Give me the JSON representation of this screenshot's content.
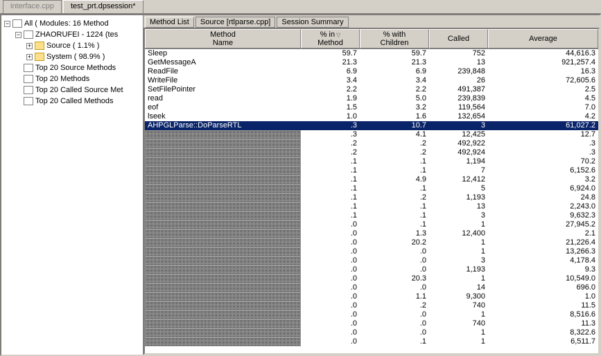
{
  "topTabs": [
    {
      "label": "interface.cpp",
      "active": false
    },
    {
      "label": "test_prt.dpsession*",
      "active": true
    }
  ],
  "tree": {
    "root": {
      "label": "All ( Modules: 16 Method"
    },
    "child1": {
      "label": "ZHAORUFEI - 1224 (tes"
    },
    "leaf1": {
      "label": "Source ( 1.1% )"
    },
    "leaf2": {
      "label": "System ( 98.9% )"
    },
    "t1": {
      "label": "Top 20 Source Methods"
    },
    "t2": {
      "label": "Top 20 Methods"
    },
    "t3": {
      "label": "Top 20 Called Source Met"
    },
    "t4": {
      "label": "Top 20 Called Methods"
    }
  },
  "innerTabs": [
    {
      "label": "Method List",
      "active": true
    },
    {
      "label": "Source [rtlparse.cpp]",
      "active": false
    },
    {
      "label": "Session Summary",
      "active": false
    }
  ],
  "columns": {
    "name1": "Method",
    "name2": "Name",
    "pct1": "% in",
    "pct2": "Method",
    "pctc1": "% with",
    "pctc2": "Children",
    "called": "Called",
    "avg": "Average"
  },
  "rows": [
    {
      "name": "Sleep",
      "pct": "59.7",
      "pctc": "59.7",
      "called": "752",
      "avg": "44,616.3",
      "obs": false,
      "sel": false
    },
    {
      "name": "GetMessageA",
      "pct": "21.3",
      "pctc": "21.3",
      "called": "13",
      "avg": "921,257.4",
      "obs": false,
      "sel": false
    },
    {
      "name": "ReadFile",
      "pct": "6.9",
      "pctc": "6.9",
      "called": "239,848",
      "avg": "16.3",
      "obs": false,
      "sel": false
    },
    {
      "name": "WriteFile",
      "pct": "3.4",
      "pctc": "3.4",
      "called": "26",
      "avg": "72,605.6",
      "obs": false,
      "sel": false
    },
    {
      "name": "SetFilePointer",
      "pct": "2.2",
      "pctc": "2.2",
      "called": "491,387",
      "avg": "2.5",
      "obs": false,
      "sel": false
    },
    {
      "name": "read",
      "pct": "1.9",
      "pctc": "5.0",
      "called": "239,839",
      "avg": "4.5",
      "obs": false,
      "sel": false
    },
    {
      "name": "eof",
      "pct": "1.5",
      "pctc": "3.2",
      "called": "119,564",
      "avg": "7.0",
      "obs": false,
      "sel": false
    },
    {
      "name": "lseek",
      "pct": "1.0",
      "pctc": "1.6",
      "called": "132,654",
      "avg": "4.2",
      "obs": false,
      "sel": false
    },
    {
      "name": "AHPGLParse::DoParseRTL",
      "pct": ".3",
      "pctc": "10.7",
      "called": "3",
      "avg": "61,027.2",
      "obs": false,
      "sel": true
    },
    {
      "name": "",
      "pct": ".3",
      "pctc": "4.1",
      "called": "12,425",
      "avg": "12.7",
      "obs": true,
      "sel": false
    },
    {
      "name": "",
      "pct": ".2",
      "pctc": ".2",
      "called": "492,922",
      "avg": ".3",
      "obs": true,
      "sel": false
    },
    {
      "name": "",
      "pct": ".2",
      "pctc": ".2",
      "called": "492,924",
      "avg": ".3",
      "obs": true,
      "sel": false
    },
    {
      "name": "",
      "pct": ".1",
      "pctc": ".1",
      "called": "1,194",
      "avg": "70.2",
      "obs": true,
      "sel": false
    },
    {
      "name": "",
      "pct": ".1",
      "pctc": ".1",
      "called": "7",
      "avg": "6,152.6",
      "obs": true,
      "sel": false
    },
    {
      "name": "",
      "pct": ".1",
      "pctc": "4.9",
      "called": "12,412",
      "avg": "3.2",
      "obs": true,
      "sel": false
    },
    {
      "name": "",
      "pct": ".1",
      "pctc": ".1",
      "called": "5",
      "avg": "6,924.0",
      "obs": true,
      "sel": false
    },
    {
      "name": "",
      "pct": ".1",
      "pctc": ".2",
      "called": "1,193",
      "avg": "24.8",
      "obs": true,
      "sel": false
    },
    {
      "name": "",
      "pct": ".1",
      "pctc": ".1",
      "called": "13",
      "avg": "2,243.0",
      "obs": true,
      "sel": false
    },
    {
      "name": "",
      "pct": ".1",
      "pctc": ".1",
      "called": "3",
      "avg": "9,632.3",
      "obs": true,
      "sel": false
    },
    {
      "name": "",
      "pct": ".0",
      "pctc": ".1",
      "called": "1",
      "avg": "27,945.2",
      "obs": true,
      "sel": false
    },
    {
      "name": "",
      "pct": ".0",
      "pctc": "1.3",
      "called": "12,400",
      "avg": "2.1",
      "obs": true,
      "sel": false
    },
    {
      "name": "",
      "pct": ".0",
      "pctc": "20.2",
      "called": "1",
      "avg": "21,226.4",
      "obs": true,
      "sel": false
    },
    {
      "name": "",
      "pct": ".0",
      "pctc": ".0",
      "called": "1",
      "avg": "13,266.3",
      "obs": true,
      "sel": false
    },
    {
      "name": "",
      "pct": ".0",
      "pctc": ".0",
      "called": "3",
      "avg": "4,178.4",
      "obs": true,
      "sel": false
    },
    {
      "name": "",
      "pct": ".0",
      "pctc": ".0",
      "called": "1,193",
      "avg": "9.3",
      "obs": true,
      "sel": false
    },
    {
      "name": "",
      "pct": ".0",
      "pctc": "20.3",
      "called": "1",
      "avg": "10,549.0",
      "obs": true,
      "sel": false
    },
    {
      "name": "",
      "pct": ".0",
      "pctc": ".0",
      "called": "14",
      "avg": "696.0",
      "obs": true,
      "sel": false
    },
    {
      "name": "",
      "pct": ".0",
      "pctc": "1.1",
      "called": "9,300",
      "avg": "1.0",
      "obs": true,
      "sel": false
    },
    {
      "name": "",
      "pct": ".0",
      "pctc": ".2",
      "called": "740",
      "avg": "11.5",
      "obs": true,
      "sel": false
    },
    {
      "name": "",
      "pct": ".0",
      "pctc": ".0",
      "called": "1",
      "avg": "8,516.6",
      "obs": true,
      "sel": false
    },
    {
      "name": "",
      "pct": ".0",
      "pctc": ".0",
      "called": "740",
      "avg": "11.3",
      "obs": true,
      "sel": false
    },
    {
      "name": "",
      "pct": ".0",
      "pctc": ".0",
      "called": "1",
      "avg": "8,322.6",
      "obs": true,
      "sel": false
    },
    {
      "name": "",
      "pct": ".0",
      "pctc": ".1",
      "called": "1",
      "avg": "6,511.7",
      "obs": true,
      "sel": false
    }
  ]
}
